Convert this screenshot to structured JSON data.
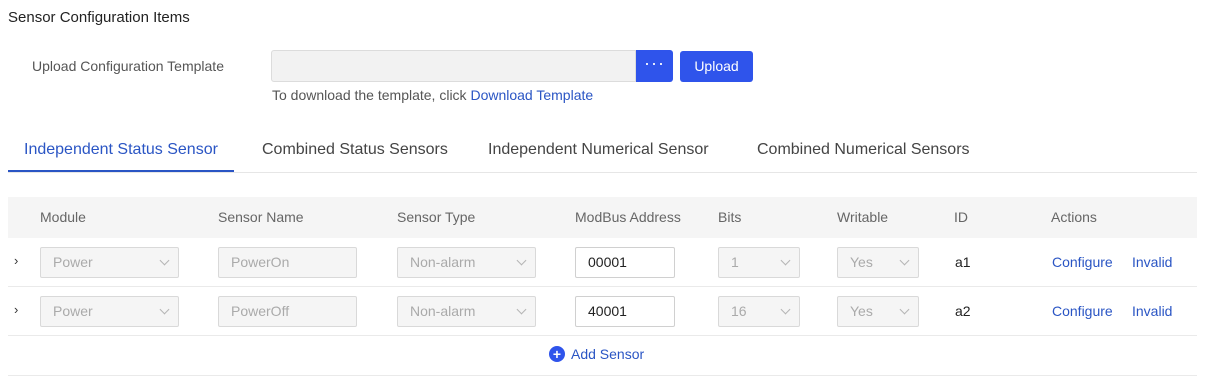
{
  "section": {
    "title": "Sensor Configuration Items"
  },
  "upload": {
    "label": "Upload Configuration Template",
    "file_value": "",
    "browse_label": "···",
    "upload_label": "Upload",
    "hint_text": "To download the template, click ",
    "download_link": "Download Template"
  },
  "tabs": [
    {
      "label": "Independent Status Sensor",
      "active": true
    },
    {
      "label": "Combined Status Sensors",
      "active": false
    },
    {
      "label": "Independent Numerical Sensor",
      "active": false
    },
    {
      "label": "Combined Numerical Sensors",
      "active": false
    }
  ],
  "table": {
    "headers": [
      "Module",
      "Sensor Name",
      "Sensor Type",
      "ModBus Address",
      "Bits",
      "Writable",
      "ID",
      "Actions"
    ],
    "rows": [
      {
        "expand": "›",
        "module": "Power",
        "sensor_name": "PowerOn",
        "sensor_type": "Non-alarm",
        "modbus_address": "00001",
        "bits": "1",
        "writable": "Yes",
        "id": "a1",
        "configure": "Configure",
        "invalid": "Invalid"
      },
      {
        "expand": "›",
        "module": "Power",
        "sensor_name": "PowerOff",
        "sensor_type": "Non-alarm",
        "modbus_address": "40001",
        "bits": "16",
        "writable": "Yes",
        "id": "a2",
        "configure": "Configure",
        "invalid": "Invalid"
      }
    ],
    "add_label": "Add Sensor"
  },
  "colors": {
    "accent": "#2f54eb",
    "link": "#2a55c4",
    "header_bg": "#f5f5f5"
  },
  "icons": {
    "browse": "ellipsis-icon",
    "expand": "chevron-right-icon",
    "select": "chevron-down-icon",
    "add": "plus-circle-icon"
  }
}
